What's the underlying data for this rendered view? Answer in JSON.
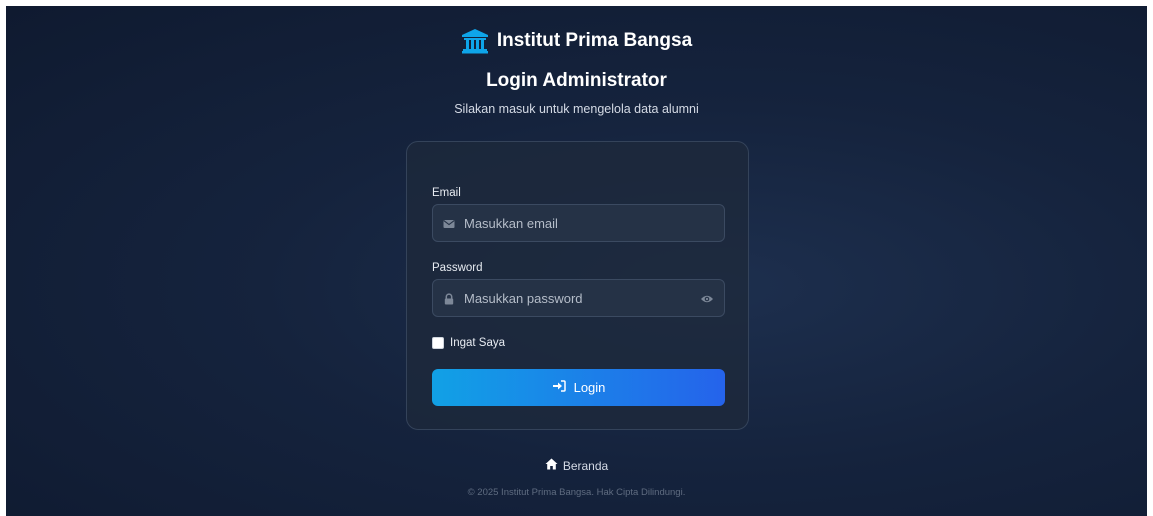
{
  "brand": {
    "name": "Institut Prima Bangsa",
    "icon": "university-icon",
    "icon_color": "#0ea5e9"
  },
  "header": {
    "title": "Login Administrator",
    "subtitle": "Silakan masuk untuk mengelola data alumni"
  },
  "form": {
    "email": {
      "label": "Email",
      "placeholder": "Masukkan email",
      "value": "",
      "icon": "envelope-icon"
    },
    "password": {
      "label": "Password",
      "placeholder": "Masukkan password",
      "value": "",
      "icon": "lock-icon",
      "toggle_icon": "eye-icon"
    },
    "remember": {
      "label": "Ingat Saya",
      "checked": false
    },
    "submit": {
      "label": "Login",
      "icon": "sign-in-icon"
    }
  },
  "footer": {
    "home_label": "Beranda",
    "home_icon": "home-icon",
    "copyright": "© 2025 Institut Prima Bangsa. Hak Cipta Dilindungi."
  },
  "colors": {
    "background": "#15233d",
    "accent_start": "#11a1e6",
    "accent_end": "#2563eb"
  }
}
